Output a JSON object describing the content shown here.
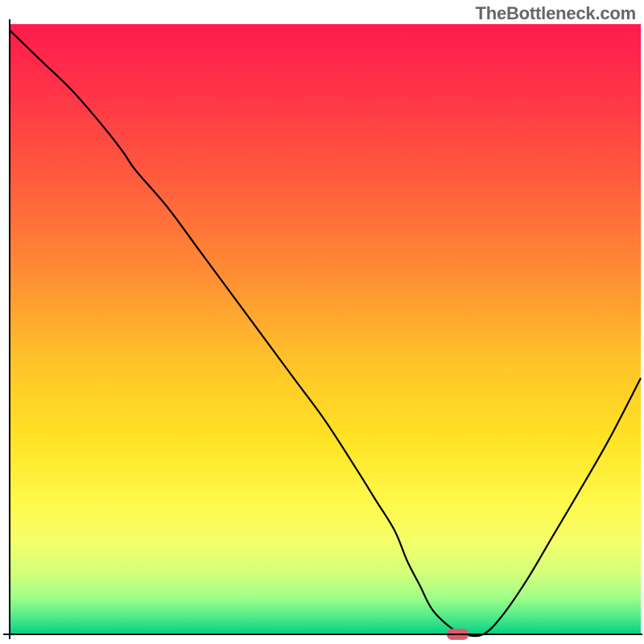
{
  "watermark": "TheBottleneck.com",
  "chart_data": {
    "type": "line",
    "title": "",
    "xlabel": "",
    "ylabel": "",
    "xlim": [
      0,
      100
    ],
    "ylim": [
      0,
      100
    ],
    "grid": false,
    "legend": false,
    "background": {
      "type": "vertical-gradient",
      "stops": [
        {
          "offset": 0,
          "color": "#ff1a4d"
        },
        {
          "offset": 12,
          "color": "#ff3647"
        },
        {
          "offset": 25,
          "color": "#ff5a3e"
        },
        {
          "offset": 40,
          "color": "#ff8a34"
        },
        {
          "offset": 55,
          "color": "#ffc22a"
        },
        {
          "offset": 68,
          "color": "#ffe324"
        },
        {
          "offset": 78,
          "color": "#fff84a"
        },
        {
          "offset": 85,
          "color": "#f4ff6a"
        },
        {
          "offset": 90,
          "color": "#d4ff7a"
        },
        {
          "offset": 94,
          "color": "#9eff87"
        },
        {
          "offset": 97,
          "color": "#55eb8a"
        },
        {
          "offset": 100,
          "color": "#00d084"
        }
      ]
    },
    "series": [
      {
        "name": "bottleneck-curve",
        "color": "#000000",
        "x": [
          0,
          5,
          10,
          15,
          18,
          20,
          25,
          30,
          35,
          40,
          45,
          50,
          55,
          58,
          61,
          63,
          65,
          67,
          70,
          72,
          75,
          78,
          82,
          86,
          90,
          95,
          100
        ],
        "y": [
          99,
          94,
          89,
          83,
          79,
          76,
          70,
          63,
          56,
          49,
          42,
          35,
          27,
          22,
          17,
          12,
          8,
          4,
          1,
          0,
          0,
          3,
          9,
          16,
          23,
          32,
          42
        ]
      }
    ],
    "marker": {
      "name": "optimal-point",
      "shape": "rounded-rect",
      "x": 71,
      "y": 0,
      "width": 3.5,
      "height": 1.8,
      "color": "#e05a6a"
    },
    "axes": {
      "color": "#000000",
      "stroke_width": 2
    }
  }
}
